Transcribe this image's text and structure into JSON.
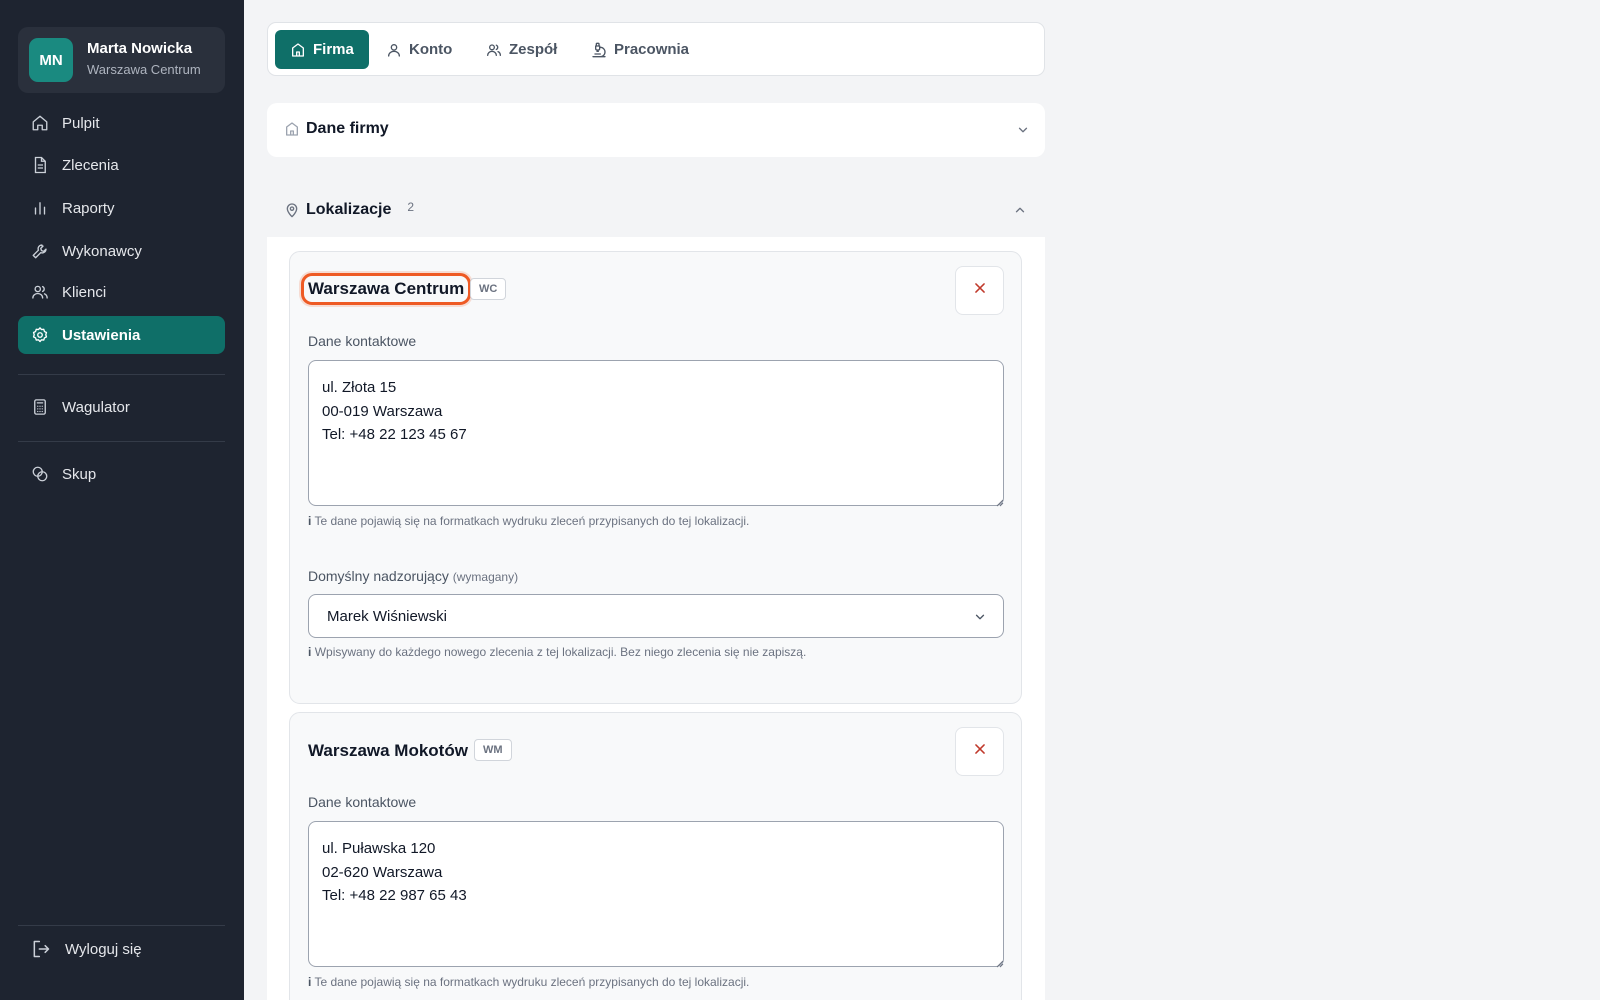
{
  "user": {
    "initials": "MN",
    "name": "Marta Nowicka",
    "location": "Warszawa Centrum"
  },
  "sidebar": {
    "items": [
      {
        "label": "Pulpit",
        "icon": "home-icon"
      },
      {
        "label": "Zlecenia",
        "icon": "document-icon"
      },
      {
        "label": "Raporty",
        "icon": "bar-chart-icon"
      },
      {
        "label": "Wykonawcy",
        "icon": "wrench-icon"
      },
      {
        "label": "Klienci",
        "icon": "users-icon"
      },
      {
        "label": "Ustawienia",
        "icon": "gear-icon",
        "active": true
      },
      {
        "label": "Wagulator",
        "icon": "calculator-icon"
      },
      {
        "label": "Skup",
        "icon": "coins-icon"
      }
    ],
    "logout_label": "Wyloguj się"
  },
  "tabs": [
    {
      "label": "Firma",
      "icon": "building-icon",
      "active": true
    },
    {
      "label": "Konto",
      "icon": "user-icon"
    },
    {
      "label": "Zespół",
      "icon": "team-icon"
    },
    {
      "label": "Pracownia",
      "icon": "microscope-icon"
    }
  ],
  "sections": {
    "company": {
      "title": "Dane firmy",
      "expanded": false
    },
    "locations": {
      "title": "Lokalizacje",
      "count": "2",
      "expanded": true
    }
  },
  "locations": [
    {
      "name": "Warszawa Centrum",
      "code": "WC",
      "contact_label": "Dane kontaktowe",
      "contact_value": "ul. Złota 15\n00-019 Warszawa\nTel: +48 22 123 45 67",
      "contact_hint_marker": "i",
      "contact_hint": "Te dane pojawią się na formatkach wydruku zleceń przypisanych do tej lokalizacji.",
      "supervisor_label": "Domyślny nadzorujący",
      "supervisor_required": "(wymagany)",
      "supervisor_value": "Marek Wiśniewski",
      "supervisor_hint_marker": "i",
      "supervisor_hint": "Wpisywany do każdego nowego zlecenia z tej lokalizacji. Bez niego zlecenia się nie zapiszą."
    },
    {
      "name": "Warszawa Mokotów",
      "code": "WM",
      "contact_label": "Dane kontaktowe",
      "contact_value": "ul. Puławska 120\n02-620 Warszawa\nTel: +48 22 987 65 43",
      "contact_hint_marker": "i",
      "contact_hint": "Te dane pojawią się na formatkach wydruku zleceń przypisanych do tej lokalizacji."
    }
  ],
  "colors": {
    "sidebar_bg": "#1e2430",
    "accent": "#0f6f68",
    "focus_ring": "#ee5a24",
    "delete": "#c0392b"
  }
}
